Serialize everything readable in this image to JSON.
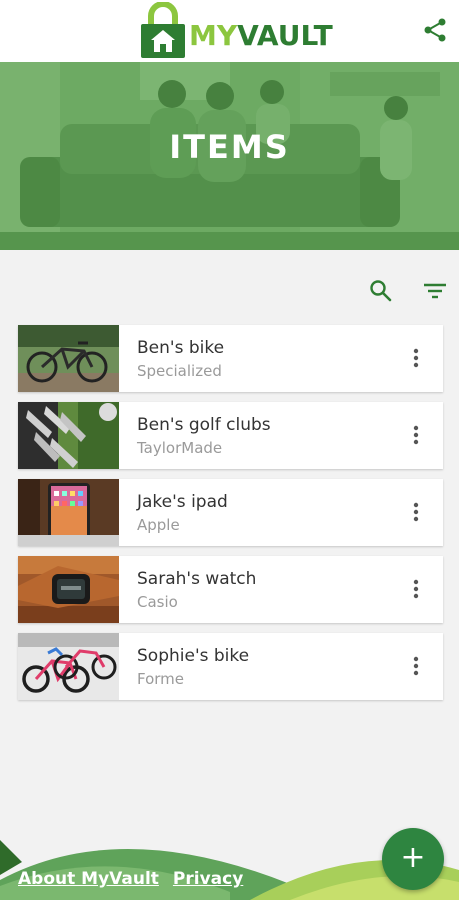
{
  "app": {
    "logo_my": "MY",
    "logo_vault": "VAULT"
  },
  "hero": {
    "title": "ITEMS"
  },
  "toolbar": {
    "search_icon": "search-icon",
    "filter_icon": "filter-icon"
  },
  "items": [
    {
      "title": "Ben's bike",
      "subtitle": "Specialized",
      "image": "mountain-bike-photo"
    },
    {
      "title": "Ben's golf clubs",
      "subtitle": "TaylorMade",
      "image": "golf-clubs-photo"
    },
    {
      "title": "Jake's ipad",
      "subtitle": "Apple",
      "image": "ipad-photo"
    },
    {
      "title": "Sarah's watch",
      "subtitle": "Casio",
      "image": "watch-photo"
    },
    {
      "title": "Sophie's bike",
      "subtitle": "Forme",
      "image": "kids-bikes-photo"
    }
  ],
  "footer": {
    "about_label": "About MyVault",
    "privacy_label": "Privacy"
  },
  "fab": {
    "label": "+"
  },
  "colors": {
    "brand_green": "#2e7d32",
    "brand_light_green": "#8cc63f",
    "fab_green": "#2e8540",
    "hero_overlay": "#5a9a50"
  }
}
